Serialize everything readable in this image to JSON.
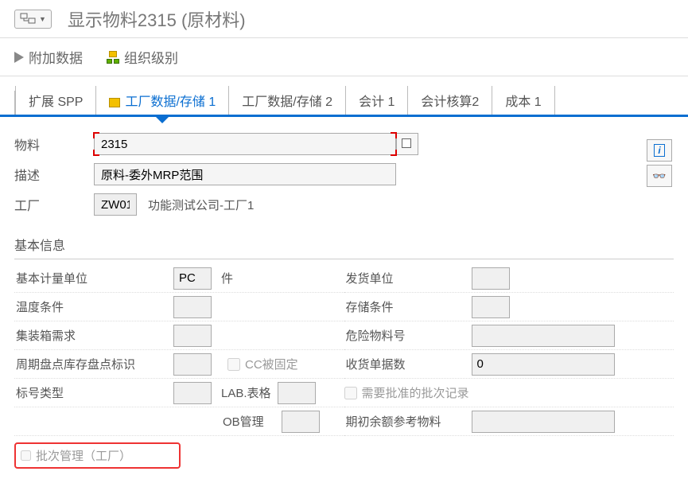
{
  "header": {
    "title": "显示物料2315 (原材料)"
  },
  "toolbar": {
    "append": "附加数据",
    "org": "组织级别"
  },
  "tabs": [
    {
      "label": "扩展 SPP"
    },
    {
      "label": "工厂数据/存储 1",
      "active": true
    },
    {
      "label": "工厂数据/存储 2"
    },
    {
      "label": "会计 1"
    },
    {
      "label": "会计核算2"
    },
    {
      "label": "成本 1"
    }
  ],
  "form": {
    "material_label": "物料",
    "material_value": "2315",
    "desc_label": "描述",
    "desc_value": "原料-委外MRP范围",
    "plant_label": "工厂",
    "plant_code": "ZW01",
    "plant_name": "功能测试公司-工厂1"
  },
  "section": {
    "basic_info": "基本信息"
  },
  "fields": {
    "left": {
      "uom_label": "基本计量单位",
      "uom_value": "PC",
      "uom_desc": "件",
      "temp_label": "温度条件",
      "container_label": "集装箱需求",
      "cycle_label": "周期盘点库存盘点标识",
      "cc_fixed": "CC被固定",
      "labeltype_label": "标号类型",
      "lab_form": "LAB.表格",
      "ob_mgmt": "OB管理"
    },
    "right": {
      "issue_unit": "发货单位",
      "storage_cond": "存储条件",
      "hazmat_no": "危险物料号",
      "gr_slips": "收货单据数",
      "gr_slips_value": "0",
      "approved_batch": "需要批准的批次记录",
      "init_balance": "期初余额参考物料"
    },
    "batch_mgmt": "批次管理（工厂）"
  }
}
